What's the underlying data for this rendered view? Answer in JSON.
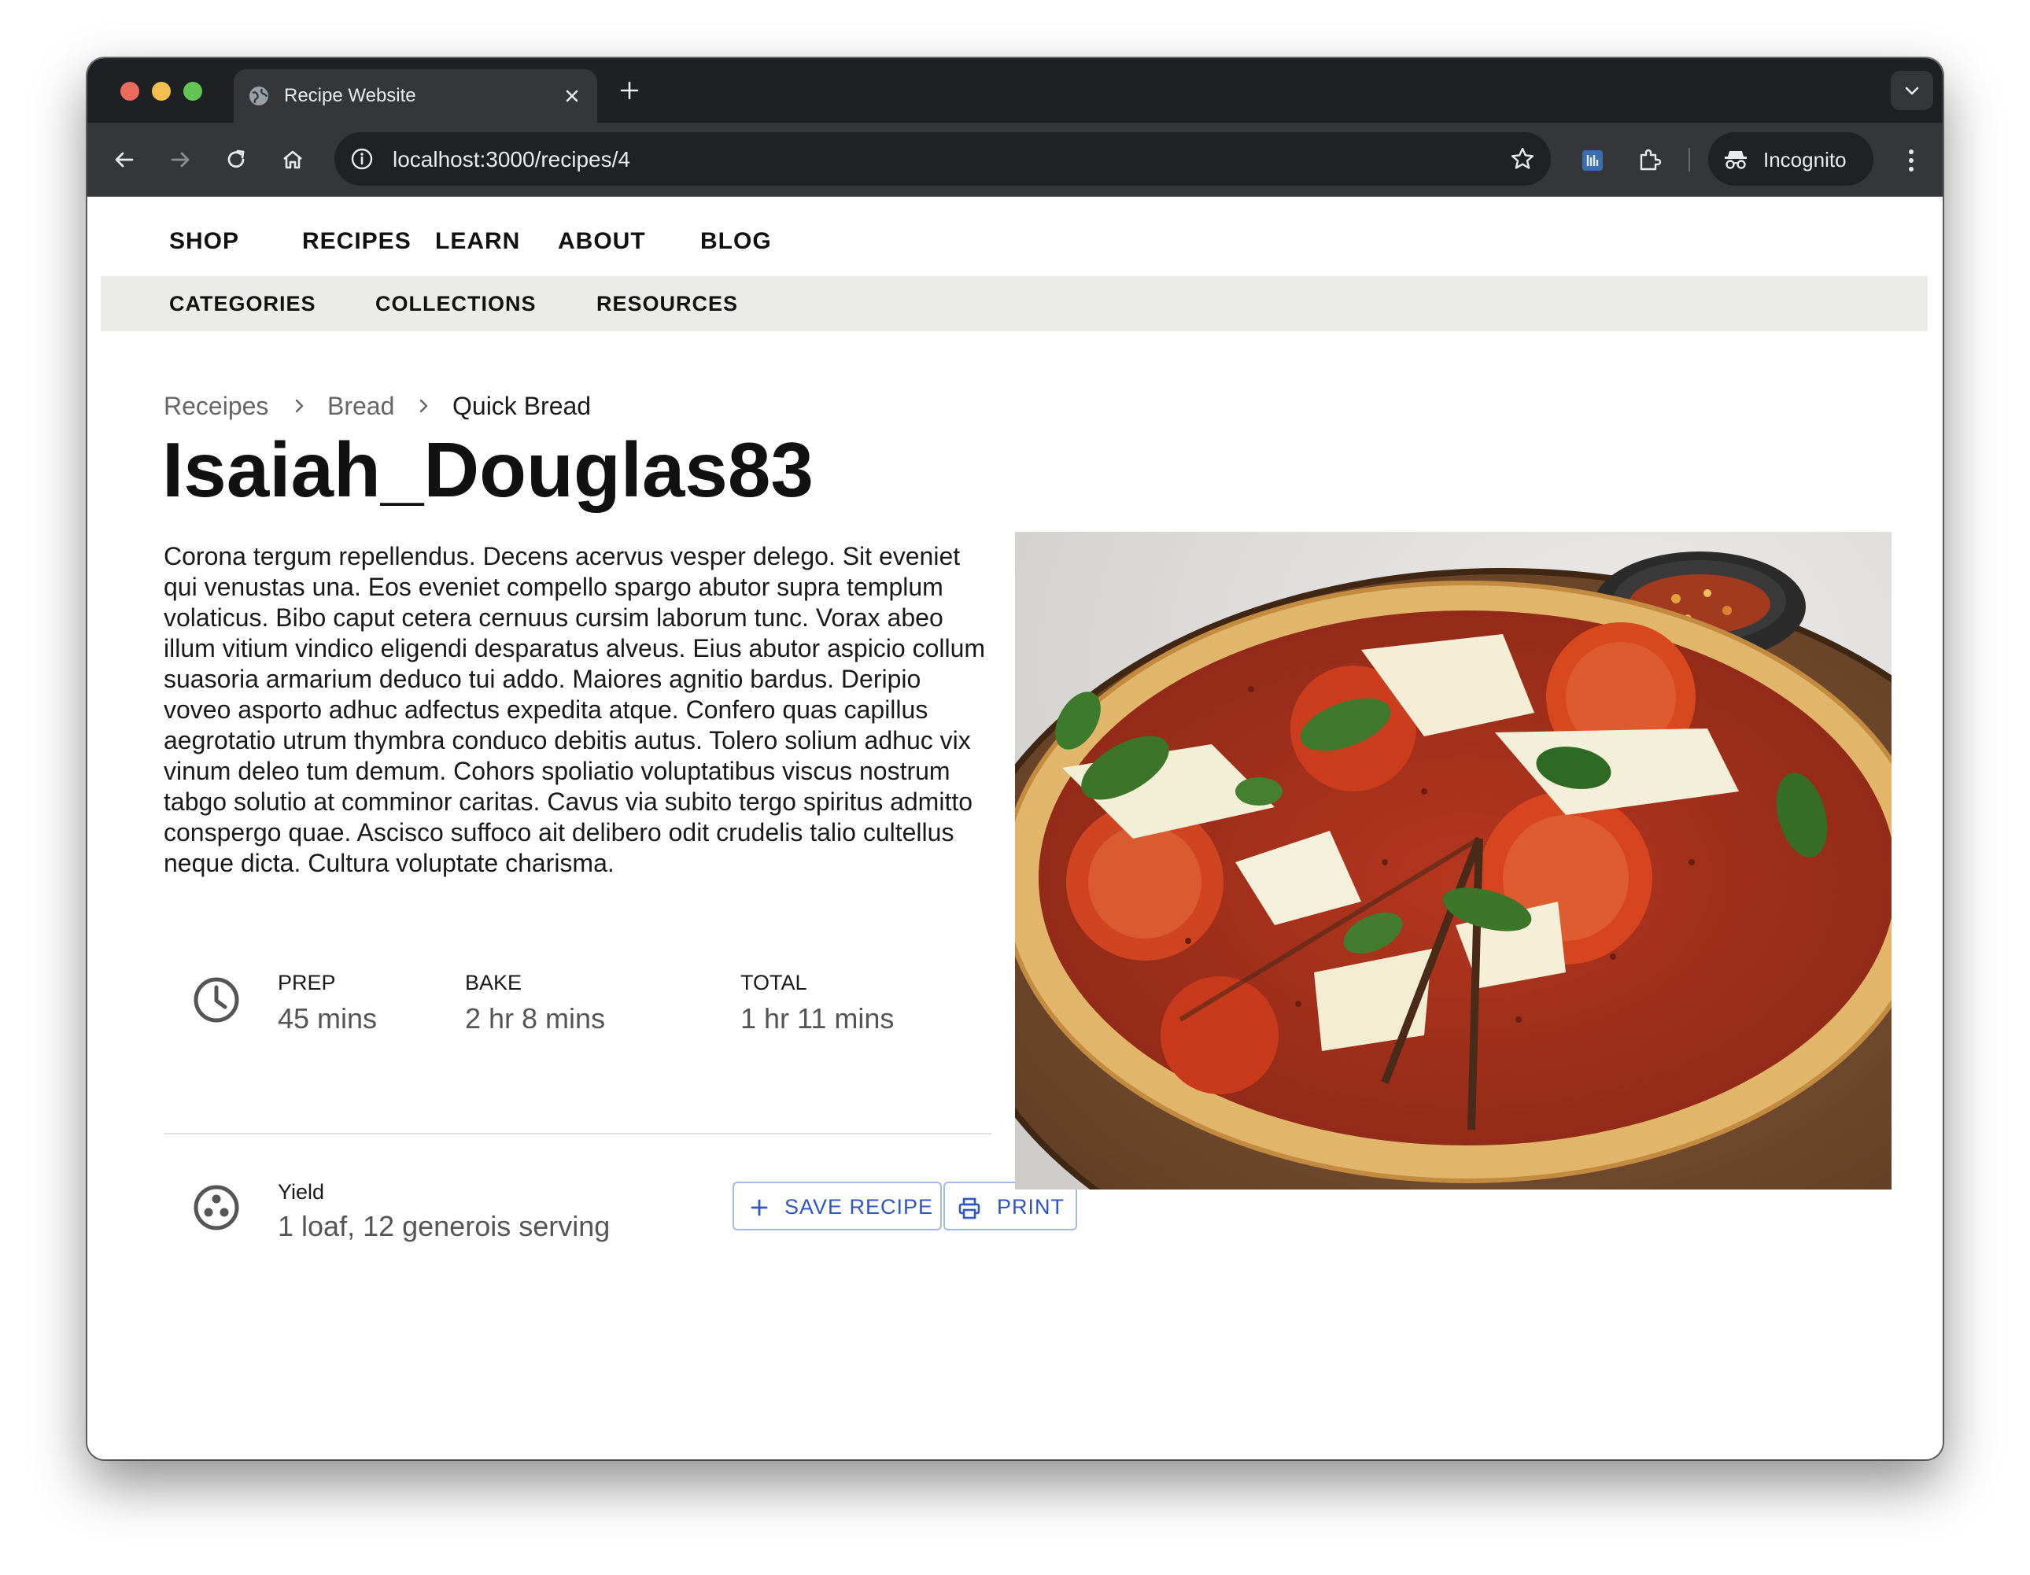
{
  "browser": {
    "tab_title": "Recipe Website",
    "url": "localhost:3000/recipes/4",
    "incognito_label": "Incognito"
  },
  "nav": {
    "main": [
      "SHOP",
      "RECIPES",
      "LEARN",
      "ABOUT",
      "BLOG"
    ],
    "sub": [
      "CATEGORIES",
      "COLLECTIONS",
      "RESOURCES"
    ]
  },
  "breadcrumb": [
    "Receipes",
    "Bread",
    "Quick Bread"
  ],
  "recipe": {
    "title": "Isaiah_Douglas83",
    "description": "Corona tergum repellendus. Decens acervus vesper delego. Sit eveniet qui venustas una. Eos eveniet compello spargo abutor supra templum volaticus. Bibo caput cetera cernuus cursim laborum tunc. Vorax abeo illum vitium vindico eligendi desparatus alveus. Eius abutor aspicio collum suasoria armarium deduco tui addo. Maiores agnitio bardus. Deripio voveo asporto adhuc adfectus expedita atque. Confero quas capillus aegrotatio utrum thymbra conduco debitis autus. Tolero solium adhuc vix vinum deleo tum demum. Cohors spoliatio voluptatibus viscus nostrum tabgo solutio at comminor caritas. Cavus via subito tergo spiritus admitto conspergo quae. Ascisco suffoco ait delibero odit crudelis talio cultellus neque dicta. Cultura voluptate charisma.",
    "prep_label": "PREP",
    "prep_value": "45 mins",
    "bake_label": "BAKE",
    "bake_value": "2 hr 8 mins",
    "total_label": "TOTAL",
    "total_value": "1 hr 11 mins",
    "yield_label": "Yield",
    "yield_value": "1 loaf, 12 generois serving"
  },
  "actions": {
    "save_label": "SAVE RECIPE",
    "print_label": "PRINT"
  },
  "icons": {
    "clock": "clock-icon",
    "yield": "yield-icon",
    "save": "plus-icon",
    "print": "printer-icon"
  },
  "colors": {
    "accent": "#2f55c8",
    "subnav_bg": "#ebebe9",
    "browser_chrome": "#35363a"
  }
}
